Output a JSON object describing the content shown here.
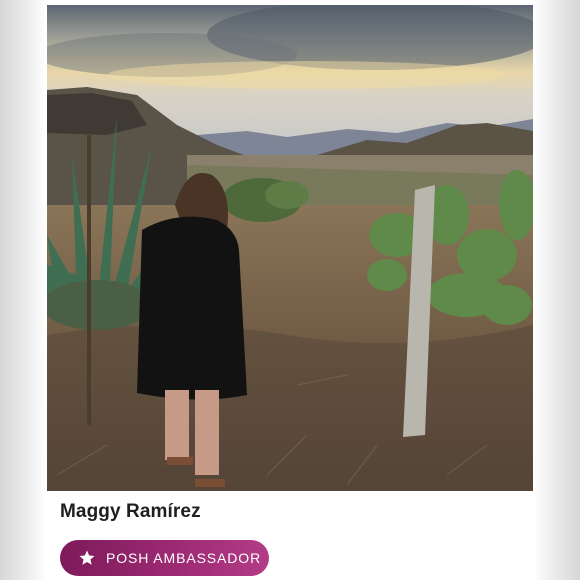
{
  "profile": {
    "name": "Maggy Ramírez",
    "badge_label": "POSH AMBASSADOR",
    "badge_icon": "star-icon"
  },
  "colors": {
    "badge_start": "#7e1a5a",
    "badge_end": "#b33c86",
    "name_text": "#1f1f1f"
  }
}
